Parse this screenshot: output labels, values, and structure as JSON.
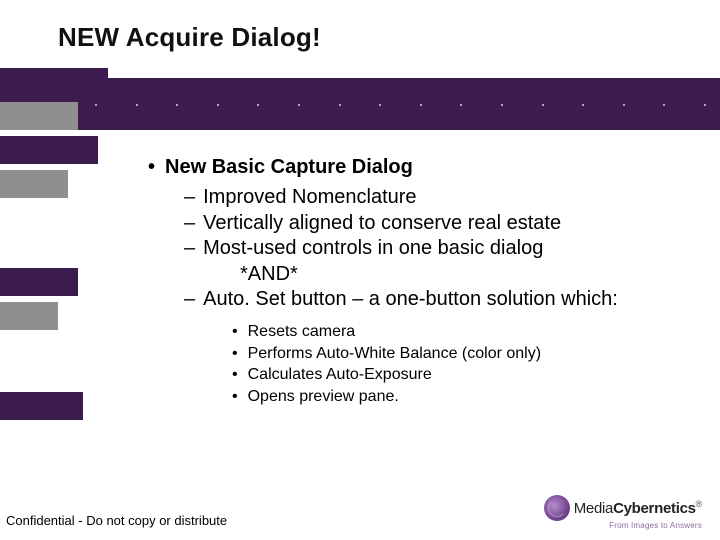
{
  "title": "NEW Acquire Dialog!",
  "bullets": {
    "main": "New Basic Capture Dialog",
    "sub": [
      "Improved Nomenclature",
      "Vertically aligned to conserve real estate",
      "Most-used controls in one basic dialog",
      "Auto. Set button – a one-button solution which:"
    ],
    "and_marker": "*AND*",
    "subsub": [
      "Resets camera",
      "Performs Auto-White Balance (color only)",
      "Calculates Auto-Exposure",
      "Opens preview pane."
    ]
  },
  "footer": "Confidential - Do not copy or distribute",
  "logo": {
    "brand_light": "Media",
    "brand_bold": "Cybernetics",
    "tagline": "From Images to Answers"
  }
}
